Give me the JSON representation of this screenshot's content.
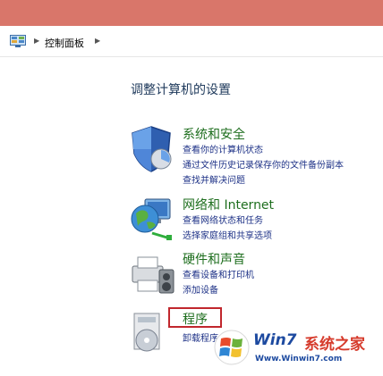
{
  "address": {
    "path_label": "控制面板"
  },
  "page_title": "调整计算机的设置",
  "categories": [
    {
      "title": "系统和安全",
      "links": [
        "查看你的计算机状态",
        "通过文件历史记录保存你的文件备份副本",
        "查找并解决问题"
      ],
      "icon": "shield-icon"
    },
    {
      "title": "网络和 Internet",
      "links": [
        "查看网络状态和任务",
        "选择家庭组和共享选项"
      ],
      "icon": "network-globe-icon"
    },
    {
      "title": "硬件和声音",
      "links": [
        "查看设备和打印机",
        "添加设备"
      ],
      "icon": "printer-icon"
    },
    {
      "title": "程序",
      "links": [
        "卸载程序"
      ],
      "icon": "programs-icon"
    }
  ],
  "watermark": {
    "brand": "Win7",
    "brand2": "系统之家",
    "url": "Www.Winwin7.com"
  },
  "colors": {
    "titlebar": "#d9766a",
    "link": "#1e3287",
    "category_title": "#1e6e1e",
    "highlight_box": "#c1272d"
  }
}
